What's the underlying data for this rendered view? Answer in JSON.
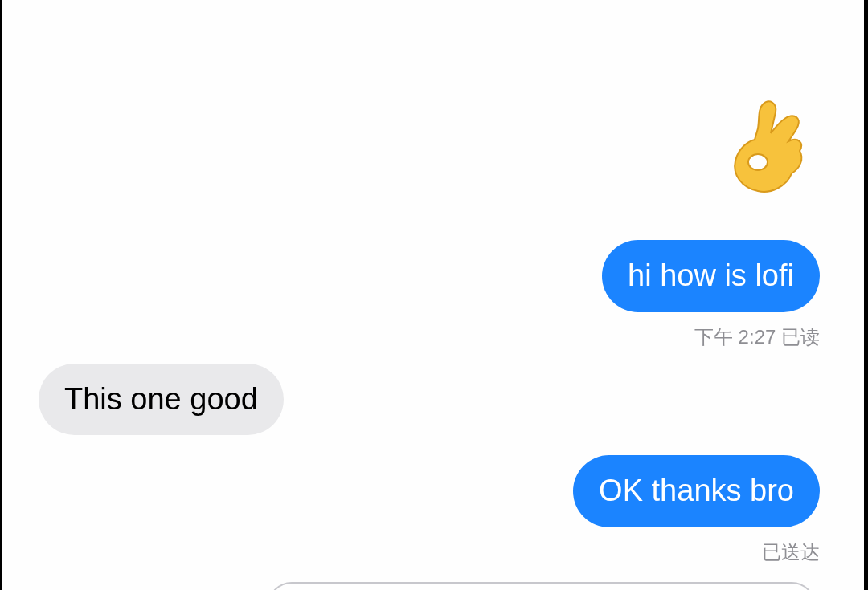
{
  "messages": [
    {
      "kind": "emoji",
      "outgoing": true
    },
    {
      "kind": "text",
      "outgoing": true,
      "text": "hi how is lofi",
      "status": "下午 2:27 已读"
    },
    {
      "kind": "text",
      "outgoing": false,
      "text": "This one good"
    },
    {
      "kind": "text",
      "outgoing": true,
      "text": "OK thanks bro",
      "status": "已送达"
    }
  ]
}
